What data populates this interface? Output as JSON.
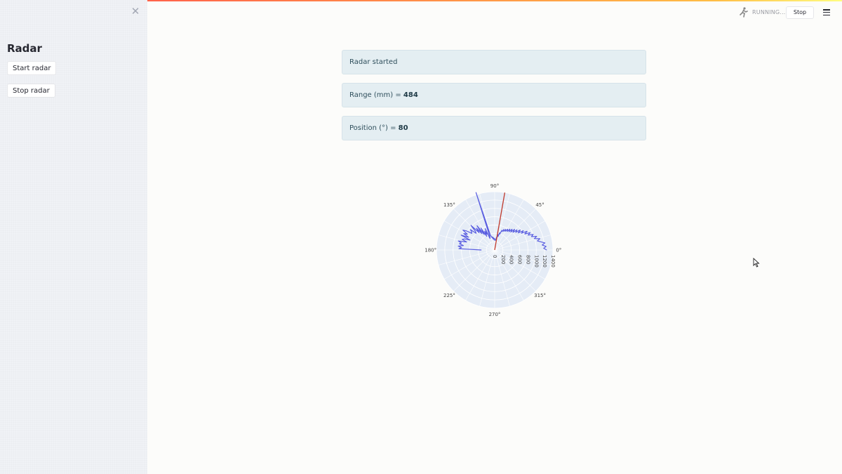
{
  "sidebar": {
    "title": "Radar",
    "close_glyph": "✕",
    "start_label": "Start radar",
    "stop_label": "Stop radar"
  },
  "header": {
    "status": "RUNNING...",
    "stop_label": "Stop",
    "status_icon": "running-man-icon",
    "menu_icon": "hamburger-menu-icon"
  },
  "messages": {
    "started": "Radar started",
    "range_label": "Range (mm) = ",
    "range_value": "484",
    "position_label": "Position (°) = ",
    "position_value": "80"
  },
  "colors": {
    "accent_red": "#ff4b4b",
    "scan_line": "#c0392b",
    "trace": "#5a5ee0",
    "polar_bg": "#e5ecf6"
  },
  "chart_data": {
    "type": "polar",
    "angular_ticks": [
      "0°",
      "45°",
      "90°",
      "135°",
      "180°",
      "225°",
      "270°",
      "315°"
    ],
    "radial_ticks": [
      0,
      200,
      400,
      600,
      800,
      1000,
      1200,
      1400
    ],
    "radial_range": [
      0,
      1400
    ],
    "sweep": {
      "name": "position",
      "theta": 80,
      "r": 1400
    },
    "series": [
      {
        "theta": [
          0,
          2,
          4,
          6,
          8,
          10,
          12,
          14,
          16,
          18,
          20,
          22,
          24,
          26,
          28,
          30,
          32,
          34,
          36,
          38,
          40,
          42,
          44,
          46,
          48,
          50,
          52,
          54,
          56,
          58,
          60,
          62,
          64,
          66,
          68,
          70,
          72,
          74,
          76,
          78,
          80,
          82,
          84,
          86,
          88,
          90,
          92,
          94,
          96,
          98,
          100,
          102,
          104,
          106,
          108,
          110,
          112,
          114,
          116,
          118,
          120,
          122,
          124,
          126,
          128,
          130,
          132,
          134,
          136,
          138,
          140,
          142,
          144,
          146,
          148,
          150,
          152,
          154,
          156,
          158,
          160,
          162,
          164,
          166,
          168,
          170,
          172,
          174,
          176,
          178,
          180
        ],
        "r": [
          1250,
          1180,
          1240,
          1150,
          1220,
          1130,
          1050,
          1120,
          990,
          1060,
          940,
          1000,
          880,
          950,
          820,
          900,
          760,
          830,
          700,
          780,
          660,
          720,
          610,
          690,
          580,
          650,
          560,
          620,
          540,
          590,
          520,
          560,
          500,
          540,
          480,
          500,
          400,
          430,
          330,
          380,
          320,
          300,
          260,
          240,
          230,
          260,
          280,
          250,
          300,
          270,
          320,
          300,
          340,
          360,
          1450,
          330,
          300,
          560,
          420,
          510,
          380,
          620,
          450,
          720,
          500,
          680,
          560,
          820,
          640,
          600,
          760,
          700,
          680,
          820,
          900,
          760,
          840,
          700,
          880,
          640,
          780,
          820,
          700,
          900,
          820,
          860,
          760,
          880,
          800,
          860,
          320
        ]
      }
    ]
  }
}
